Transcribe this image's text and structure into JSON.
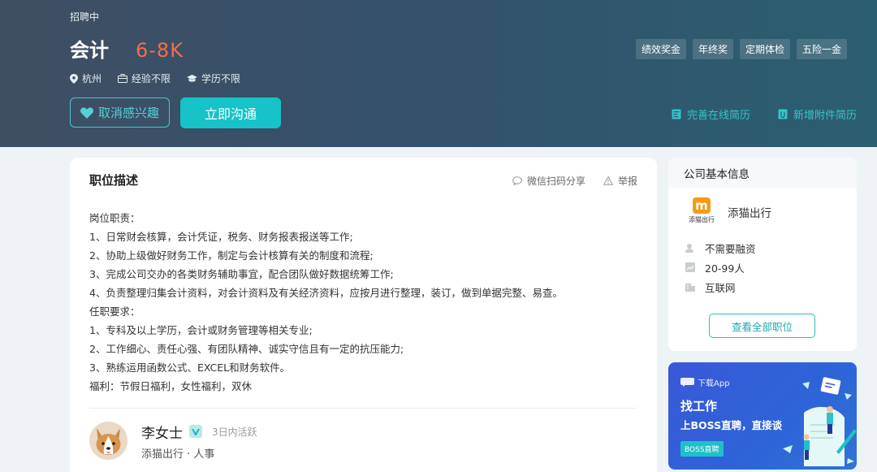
{
  "job": {
    "status": "招聘中",
    "title": "会计",
    "salary": "6-8K",
    "location": "杭州",
    "experience": "经验不限",
    "education": "学历不限",
    "benefit_tags": [
      "绩效奖金",
      "年终奖",
      "定期体检",
      "五险一金"
    ],
    "interest_button": "取消感兴趣",
    "chat_button": "立即沟通",
    "complete_resume": "完善在线简历",
    "add_attachment": "新增附件简历"
  },
  "description": {
    "section_title": "职位描述",
    "share_wechat": "微信扫码分享",
    "report": "举报",
    "lines": [
      "岗位职责：",
      "1、日常财会核算，会计凭证，税务、财务报表报送等工作;",
      "2、协助上级做好财务工作，制定与会计核算有关的制度和流程;",
      "3、完成公司交办的各类财务辅助事宜，配合团队做好数据统筹工作;",
      "4、负责整理归集会计资料，对会计资料及有关经济资料，应按月进行整理，装订，做到单据完整、易查。",
      "任职要求：",
      "1、专科及以上学历，会计或财务管理等相关专业;",
      "2、工作细心、责任心强、有团队精神、诚实守信且有一定的抗压能力;",
      "3、熟练运用函数公式、EXCEL和财务软件。",
      "福利：节假日福利，女性福利，双休"
    ]
  },
  "recruiter": {
    "name": "李女士",
    "active": "3日内活跃",
    "company_role": "添猫出行 · 人事"
  },
  "company": {
    "header": "公司基本信息",
    "logo_mark": "m",
    "logo_text": "添猫出行",
    "name": "添猫出行",
    "financing": "不需要融资",
    "size": "20-99人",
    "industry": "互联网",
    "view_all_button": "查看全部职位"
  },
  "app_banner": {
    "tag": "下载App",
    "title": "找工作",
    "subtitle": "上BOSS直聘，直接谈",
    "button": "BOSS直聘"
  },
  "colors": {
    "accent": "#15c3c8",
    "salary": "#f26d4f",
    "banner": "#34506a"
  }
}
